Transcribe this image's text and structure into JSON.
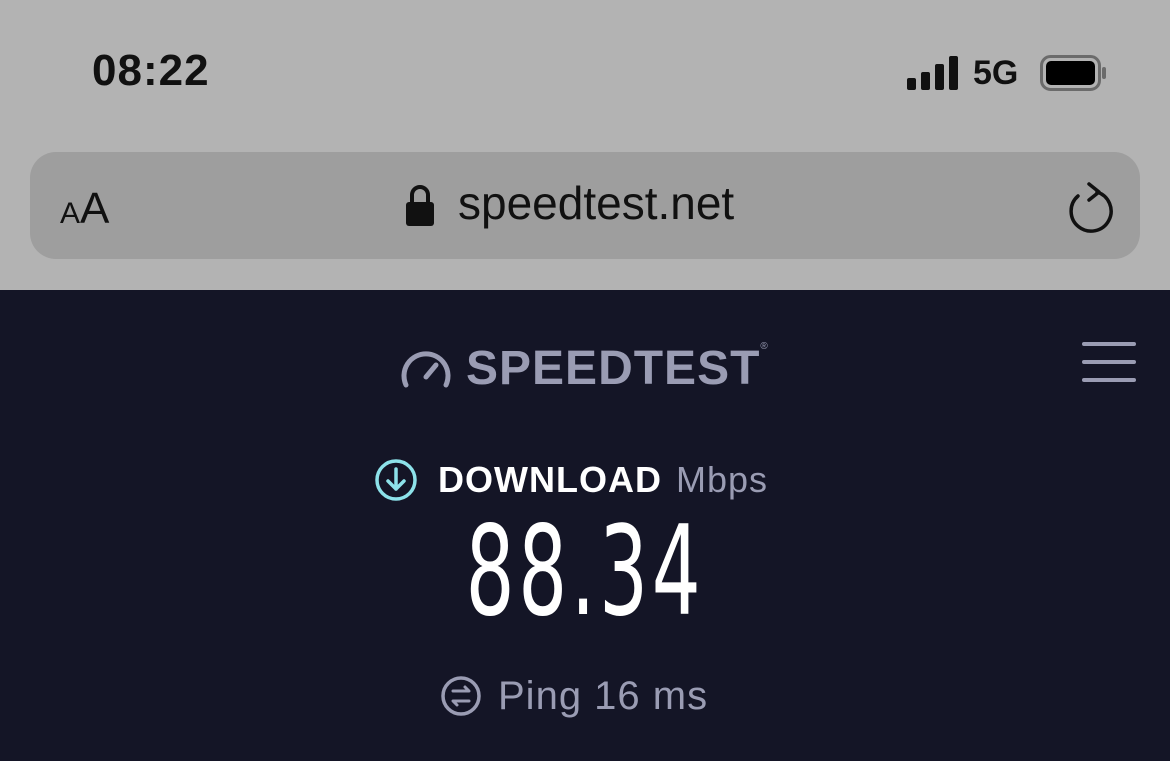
{
  "status_bar": {
    "time": "08:22",
    "carrier": "5G",
    "signal_bars": 4,
    "battery_level": 1.0
  },
  "browser": {
    "text_size_small": "A",
    "text_size_big": "A",
    "url": "speedtest.net",
    "icons": [
      "text-size-icon",
      "lock-icon",
      "reload-icon"
    ]
  },
  "header": {
    "logo_text": "SPEEDTEST",
    "trademark": "®",
    "icons": [
      "speedometer-icon",
      "hamburger-menu-icon"
    ]
  },
  "result": {
    "download_label": "DOWNLOAD",
    "unit": "Mbps",
    "download_value": "88.34",
    "ping_text": "Ping 16 ms",
    "icons": [
      "download-arrow-icon",
      "ping-icon"
    ]
  },
  "colors": {
    "background": "#141526",
    "browser_chrome": "#b3b3b3",
    "url_bar": "#9e9e9e",
    "accent_cyan": "#8de2ea",
    "muted_text": "#9a9cb3",
    "primary_text": "#ffffff"
  }
}
